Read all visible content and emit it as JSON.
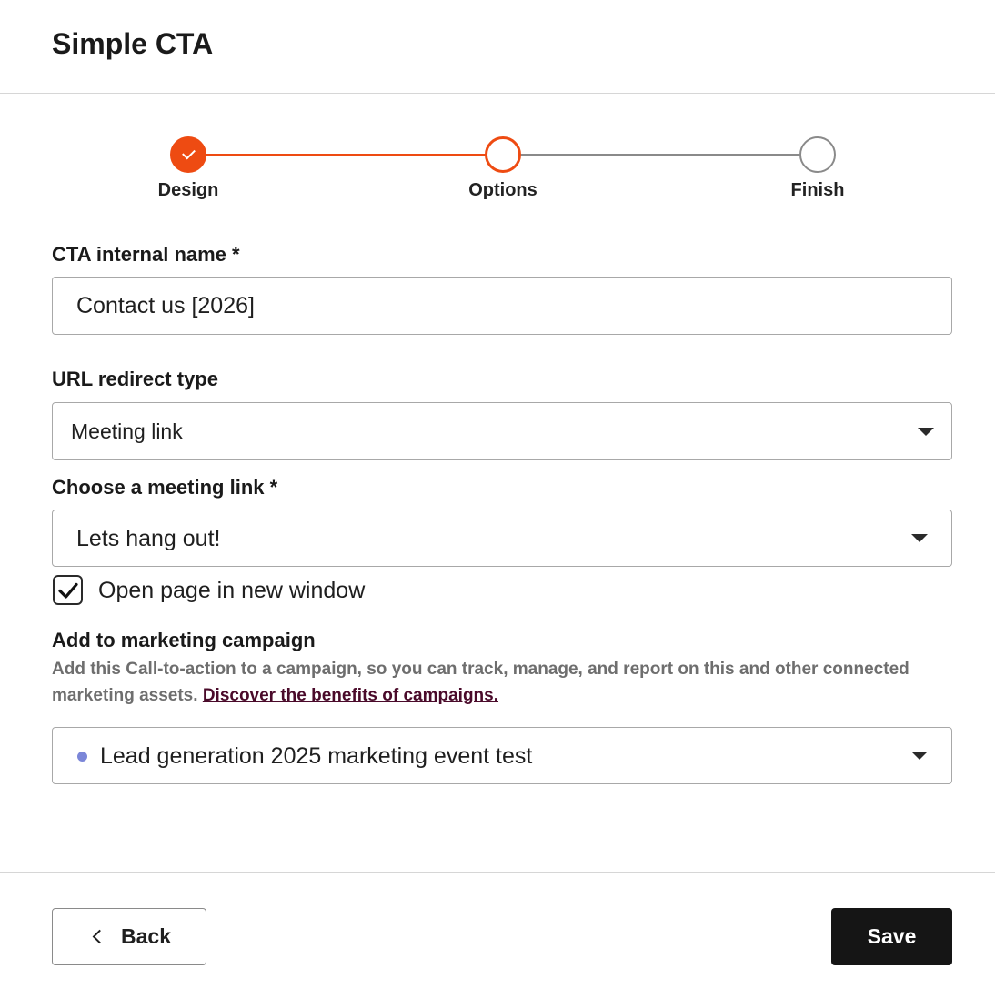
{
  "header": {
    "title": "Simple CTA"
  },
  "stepper": {
    "steps": [
      {
        "label": "Design",
        "state": "complete"
      },
      {
        "label": "Options",
        "state": "active"
      },
      {
        "label": "Finish",
        "state": "pending"
      }
    ],
    "colors": {
      "accent": "#ee4b12",
      "inactive": "#8a8a8a"
    }
  },
  "form": {
    "internal_name": {
      "label": "CTA internal name *",
      "value": "Contact us [2026]"
    },
    "redirect_type": {
      "label": "URL redirect type",
      "value": "Meeting link"
    },
    "meeting_link": {
      "label": "Choose a meeting link *",
      "value": "Lets hang out!"
    },
    "new_window": {
      "label": "Open page in new window",
      "checked": true
    },
    "campaign": {
      "label": "Add to marketing campaign",
      "help": "Add this Call-to-action to a campaign, so you can track, manage, and report on this and other connected marketing assets.",
      "help_link": "Discover the benefits of campaigns.",
      "value": "Lead generation 2025 marketing event test",
      "dot_color": "#7b86d8"
    }
  },
  "footer": {
    "back_label": "Back",
    "save_label": "Save"
  }
}
